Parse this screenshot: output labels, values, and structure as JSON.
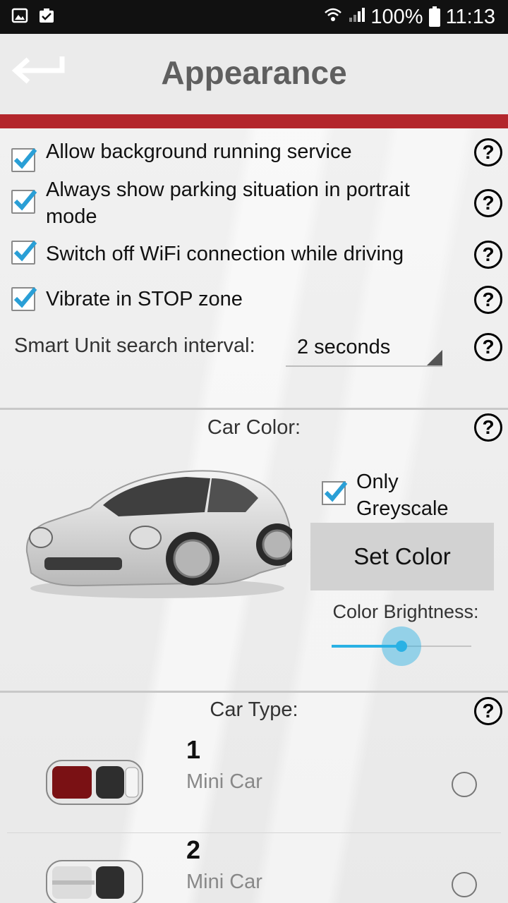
{
  "status_bar": {
    "battery_percent": "100%",
    "time": "11:13",
    "left_icons": [
      "image-icon",
      "clipboard-check-icon"
    ],
    "right_icons": [
      "wifi-icon",
      "signal-icon",
      "battery-icon"
    ]
  },
  "header": {
    "title": "Appearance",
    "accent_color": "#b3262c"
  },
  "options": [
    {
      "label": "Allow background running service",
      "checked": true,
      "help": "?"
    },
    {
      "label": "Always show parking situation in portrait mode",
      "checked": true,
      "help": "?"
    },
    {
      "label": "Switch off WiFi connection while driving",
      "checked": true,
      "help": "?"
    },
    {
      "label": "Vibrate in STOP zone",
      "checked": true,
      "help": "?"
    }
  ],
  "search_interval": {
    "label": "Smart Unit search interval:",
    "value": "2 seconds",
    "help": "?"
  },
  "car_color": {
    "title": "Car Color:",
    "help": "?",
    "only_greyscale_label": "Only Greyscale",
    "only_greyscale_checked": true,
    "set_color_label": "Set Color",
    "brightness_label": "Color Brightness:",
    "brightness_value": 0.5,
    "slider_color": "#2ab1e4"
  },
  "car_type": {
    "title": "Car Type:",
    "help": "?",
    "items": [
      {
        "number": "1",
        "type": "Mini Car",
        "selected": false
      },
      {
        "number": "2",
        "type": "Mini Car",
        "selected": false
      }
    ]
  }
}
